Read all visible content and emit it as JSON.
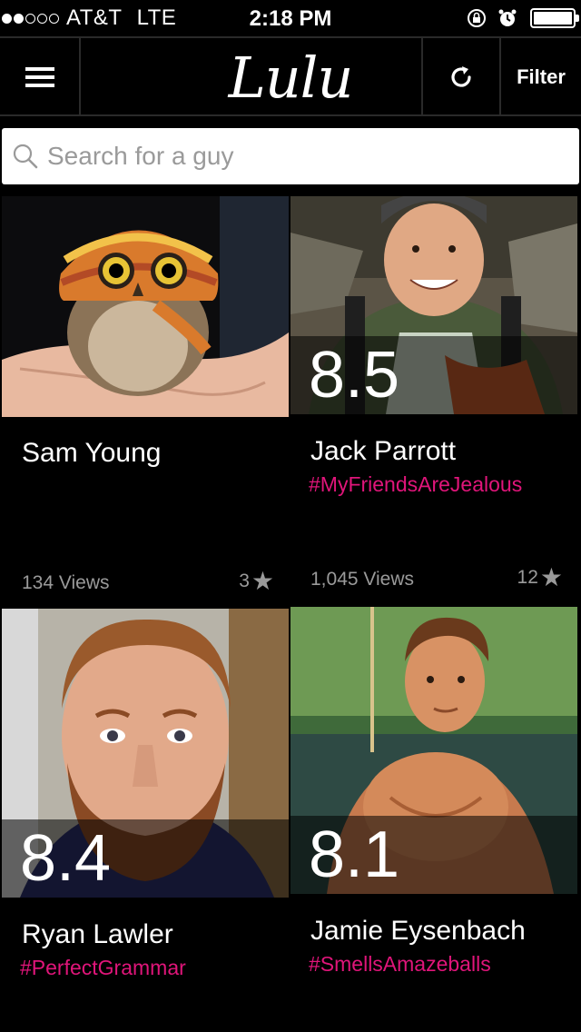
{
  "status_bar": {
    "signal_bars_filled": 2,
    "signal_bars_total": 5,
    "carrier": "AT&T",
    "network": "LTE",
    "time": "2:18 PM",
    "battery_level": 1.0
  },
  "nav": {
    "logo": "Lulu",
    "menu_icon": "hamburger-icon",
    "refresh_icon": "refresh-icon",
    "filter_label": "Filter"
  },
  "search": {
    "placeholder": "Search for a guy",
    "value": ""
  },
  "cards": [
    {
      "name": "Sam Young",
      "score": "",
      "hashtag": "",
      "views": "134 Views",
      "stars": "3",
      "photo": "owl in knit hat"
    },
    {
      "name": "Jack Parrott",
      "score": "8.5",
      "hashtag": "#MyFriendsAreJealous",
      "views": "1,045 Views",
      "stars": "12",
      "photo": "smiling man with backpack"
    },
    {
      "name": "Ryan Lawler",
      "score": "8.4",
      "hashtag": "#PerfectGrammar",
      "views": "",
      "stars": "",
      "photo": "bearded man"
    },
    {
      "name": "Jamie Eysenbach",
      "score": "8.1",
      "hashtag": "#SmellsAmazeballs",
      "views": "",
      "stars": "",
      "photo": "shirtless man by water"
    }
  ],
  "colors": {
    "hashtag": "#e0157a",
    "muted": "#9a9a9a",
    "background": "#000000"
  }
}
